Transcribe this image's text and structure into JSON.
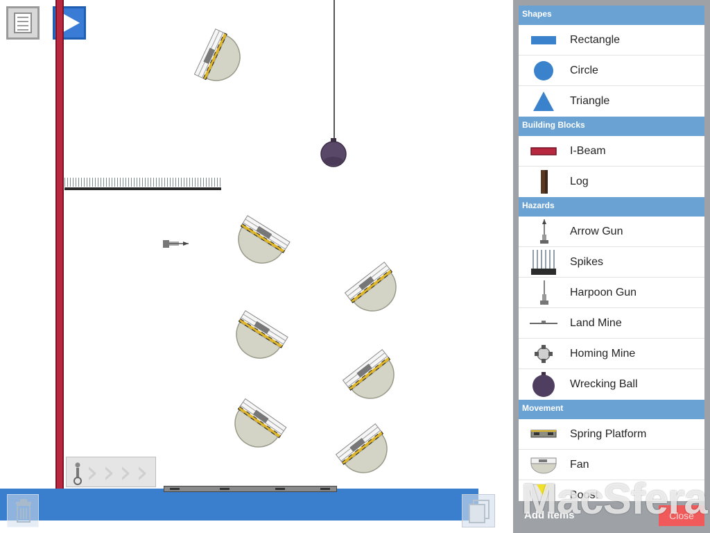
{
  "toolbar": {
    "menu_icon": "level-list-icon",
    "play_icon": "play-icon"
  },
  "canvas": {
    "objects": [
      "red-i-beam",
      "spike-strip",
      "wrecking-ball",
      "arrow-gun",
      "fans",
      "boost-pad",
      "spring-platform"
    ]
  },
  "panel": {
    "sections": [
      {
        "title": "Shapes",
        "items": [
          {
            "label": "Rectangle",
            "icon": "rectangle-icon"
          },
          {
            "label": "Circle",
            "icon": "circle-icon"
          },
          {
            "label": "Triangle",
            "icon": "triangle-icon"
          }
        ]
      },
      {
        "title": "Building Blocks",
        "items": [
          {
            "label": "I-Beam",
            "icon": "i-beam-icon"
          },
          {
            "label": "Log",
            "icon": "log-icon"
          }
        ]
      },
      {
        "title": "Hazards",
        "items": [
          {
            "label": "Arrow Gun",
            "icon": "arrow-gun-icon"
          },
          {
            "label": "Spikes",
            "icon": "spikes-icon"
          },
          {
            "label": "Harpoon Gun",
            "icon": "harpoon-gun-icon"
          },
          {
            "label": "Land Mine",
            "icon": "land-mine-icon"
          },
          {
            "label": "Homing Mine",
            "icon": "homing-mine-icon"
          },
          {
            "label": "Wrecking Ball",
            "icon": "wrecking-ball-icon"
          }
        ]
      },
      {
        "title": "Movement",
        "items": [
          {
            "label": "Spring Platform",
            "icon": "spring-platform-icon"
          },
          {
            "label": "Fan",
            "icon": "fan-icon"
          },
          {
            "label": "Boost",
            "icon": "boost-icon"
          }
        ]
      }
    ],
    "footer_title": "Add Items",
    "close_label": "Close"
  },
  "watermark": "MacSfera",
  "colors": {
    "accent": "#3a7bd5",
    "section": "#6aa3d3",
    "beam": "#b8283f",
    "floor": "#3a7fcd",
    "close": "#f15a5a"
  }
}
